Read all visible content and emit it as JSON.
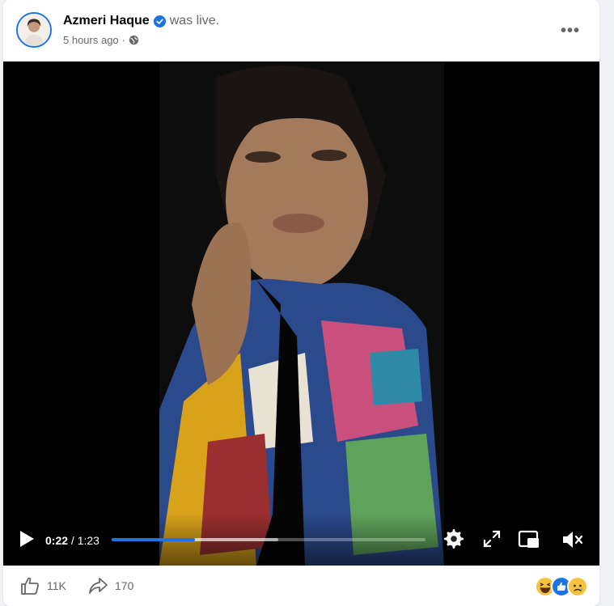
{
  "post": {
    "author": "Azmeri Haque",
    "action": "was live.",
    "timestamp": "5 hours ago",
    "separator": "·",
    "privacy_icon": "globe-icon",
    "verified_icon": "verified-badge-icon",
    "more_icon": "more-options-icon",
    "more_label": "•••"
  },
  "video": {
    "current_time": "0:22",
    "separator": " / ",
    "duration": "1:23",
    "progress_fraction": 0.265,
    "buffered_fraction": 0.53,
    "icons": [
      "play-icon",
      "settings-icon",
      "fullscreen-icon",
      "picture-in-picture-icon",
      "muted-icon"
    ]
  },
  "footer": {
    "like_count": "11K",
    "share_count": "170",
    "like_icon": "thumbs-up-icon",
    "share_icon": "share-icon",
    "reactions": [
      "haha-reaction-icon",
      "like-reaction-icon",
      "sad-reaction-icon"
    ]
  },
  "colors": {
    "accent": "#1b74e4",
    "text_primary": "#050505",
    "text_secondary": "#65676b",
    "page_background": "#f0f2f5"
  }
}
